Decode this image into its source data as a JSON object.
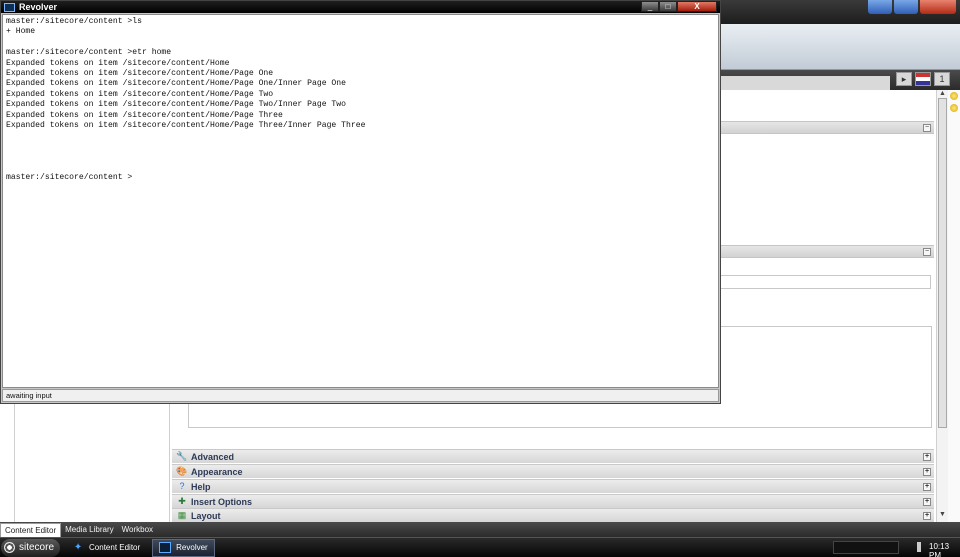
{
  "terminal": {
    "title": "Revolver",
    "lines": [
      "master:/sitecore/content >ls",
      "+ Home",
      "",
      "master:/sitecore/content >etr home",
      "Expanded tokens on item /sitecore/content/Home",
      "Expanded tokens on item /sitecore/content/Home/Page One",
      "Expanded tokens on item /sitecore/content/Home/Page One/Inner Page One",
      "Expanded tokens on item /sitecore/content/Home/Page Two",
      "Expanded tokens on item /sitecore/content/Home/Page Two/Inner Page Two",
      "Expanded tokens on item /sitecore/content/Home/Page Three",
      "Expanded tokens on item /sitecore/content/Home/Page Three/Inner Page Three",
      "",
      "",
      "",
      "",
      "master:/sitecore/content >"
    ],
    "status": "awaiting input",
    "close_glyph": "X",
    "min_glyph": "_",
    "max_glyph": "□"
  },
  "editor": {
    "sections": [
      {
        "label": "Advanced",
        "icon": "wrench-icon",
        "glyph": "🔧",
        "color": "#4a7fc1"
      },
      {
        "label": "Appearance",
        "icon": "paint-icon",
        "glyph": "🎨",
        "color": "#b35a2a"
      },
      {
        "label": "Help",
        "icon": "help-icon",
        "glyph": "?",
        "color": "#2f6fcf"
      },
      {
        "label": "Insert Options",
        "icon": "insert-options-icon",
        "glyph": "✚",
        "color": "#2a7a3a"
      },
      {
        "label": "Layout",
        "icon": "layout-icon",
        "glyph": "▦",
        "color": "#3a8a3a"
      }
    ]
  },
  "bottom_tabs": [
    "Content Editor",
    "Media Library",
    "Workbox"
  ],
  "taskbar": {
    "start_label": "sitecore",
    "items": [
      {
        "label": "Content Editor",
        "icon": "content-editor-icon",
        "glyph": "✦"
      },
      {
        "label": "Revolver",
        "icon": "terminal-icon",
        "glyph": ""
      }
    ],
    "clock": "10:13 PM"
  }
}
